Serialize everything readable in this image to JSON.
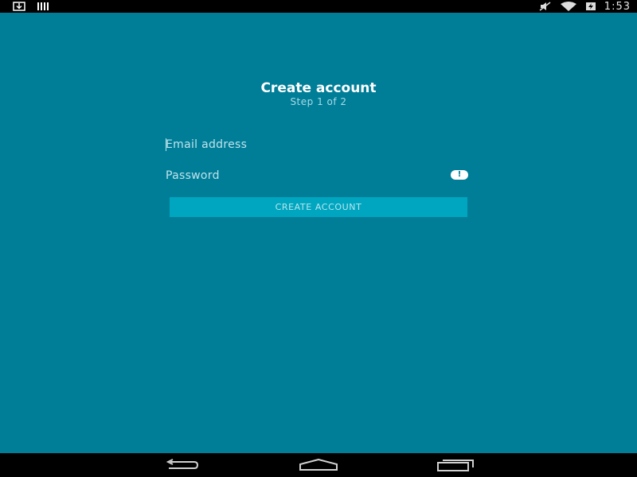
{
  "status_bar": {
    "icons_left": [
      "download-icon",
      "signal-bars-icon"
    ],
    "icons_right": [
      "mute-icon",
      "wifi-icon",
      "battery-charging-icon"
    ],
    "time": "1:53"
  },
  "form": {
    "title": "Create account",
    "subtitle": "Step 1 of 2",
    "email_placeholder": "Email address",
    "password_label": "Password",
    "password_alert_icon": "alert-icon",
    "submit_label": "CREATE ACCOUNT"
  },
  "nav_bar": {
    "icons": [
      "back-icon",
      "home-icon",
      "recents-icon"
    ]
  },
  "colors": {
    "background": "#007e98",
    "button": "#00a6c0",
    "bars": "#000000"
  }
}
